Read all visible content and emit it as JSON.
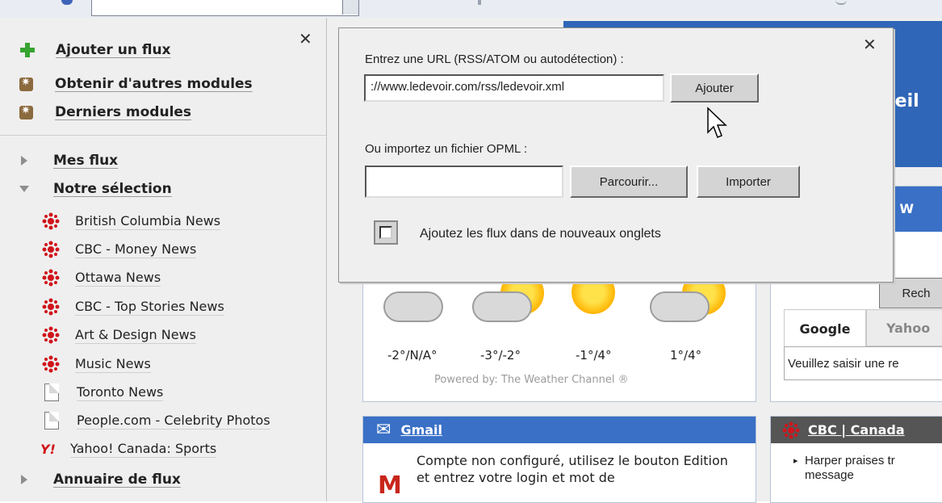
{
  "sidebar": {
    "actions": [
      {
        "label": "Ajouter un flux",
        "icon": "plus-icon"
      },
      {
        "label": "Obtenir d'autres modules",
        "icon": "module-icon"
      },
      {
        "label": "Derniers modules",
        "icon": "module-icon"
      }
    ],
    "sections": {
      "mes_flux": "Mes flux",
      "notre_selection": "Notre sélection",
      "annuaire": "Annuaire de flux"
    },
    "feeds": [
      {
        "label": "British Columbia News",
        "icon": "cbc-icon"
      },
      {
        "label": "CBC - Money News",
        "icon": "cbc-icon"
      },
      {
        "label": "Ottawa News",
        "icon": "cbc-icon"
      },
      {
        "label": "CBC - Top Stories News",
        "icon": "cbc-icon"
      },
      {
        "label": "Art & Design News",
        "icon": "cbc-icon"
      },
      {
        "label": "Music News",
        "icon": "cbc-icon"
      },
      {
        "label": "Toronto News",
        "icon": "document-icon"
      },
      {
        "label": "People.com - Celebrity Photos",
        "icon": "document-icon"
      },
      {
        "label": "Yahoo! Canada: Sports",
        "icon": "yahoo-icon"
      }
    ],
    "close_glyph": "✕"
  },
  "dialog": {
    "url_label": "Entrez une URL (RSS/ATOM ou autodétection) :",
    "url_value": "://www.ledevoir.com/rss/ledevoir.xml",
    "add_button": "Ajouter",
    "opml_label": "Ou importez un fichier OPML :",
    "opml_value": "",
    "browse_button": "Parcourir...",
    "import_button": "Importer",
    "new_tabs_label": "Ajoutez les flux dans de nouveaux onglets",
    "new_tabs_checked": false,
    "close_glyph": "✕"
  },
  "weather": {
    "temps": [
      "-2°/N/A°",
      "-3°/-2°",
      "-1°/4°",
      "1°/4°"
    ],
    "powered": "Powered by: The Weather Channel ®"
  },
  "gmail": {
    "title": "Gmail",
    "message": "Compte non configuré, utilisez le bouton Edition et entrez votre login et mot de"
  },
  "search": {
    "tabs": [
      "Google",
      "Yahoo"
    ],
    "placeholder_text": "Veuillez saisir une re",
    "search_button": "Rech",
    "top_label": "e W"
  },
  "cbc_panel": {
    "title": "CBC | Canada",
    "item": "Harper praises tr",
    "item2": "message"
  },
  "banner": {
    "text": "ueil"
  },
  "colors": {
    "accent": "#3a70c6",
    "cbc_red": "#d1141b",
    "module_brown": "#8b6a3e",
    "plus_green": "#36a430"
  }
}
